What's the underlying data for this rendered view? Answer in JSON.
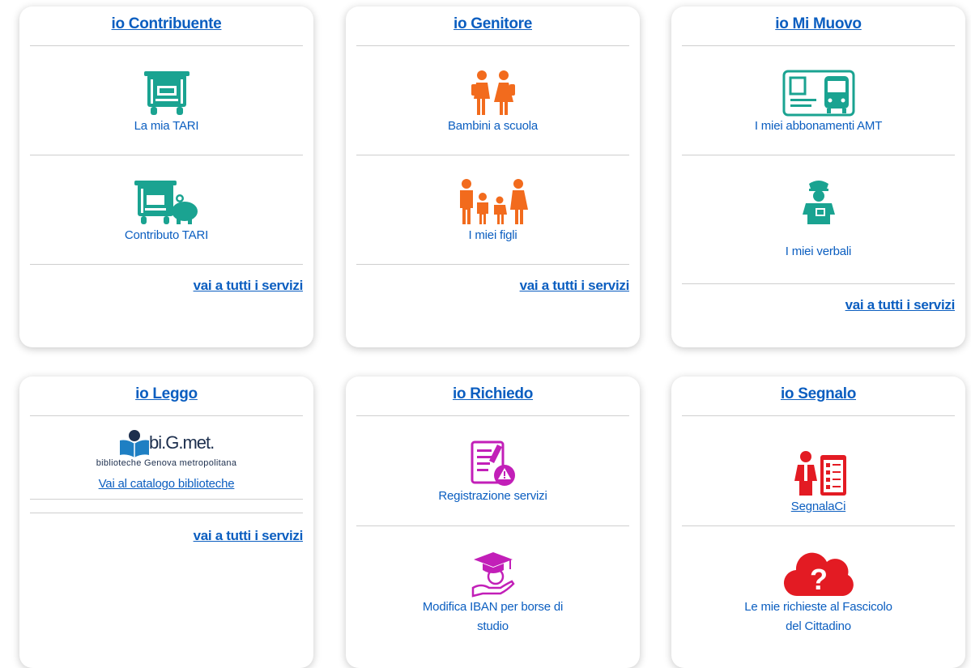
{
  "cards": {
    "contribuente": {
      "title": "io Contribuente",
      "items": [
        {
          "label": "La mia TARI",
          "icon": "garbage-bin-icon"
        },
        {
          "label": "Contributo TARI",
          "icon": "bin-piggy-bank-icon"
        }
      ],
      "all_services": "vai a tutti i servizi"
    },
    "genitore": {
      "title": "io Genitore",
      "items": [
        {
          "label": "Bambini a scuola",
          "icon": "schoolchildren-icon"
        },
        {
          "label": "I miei figli",
          "icon": "family-icon"
        }
      ],
      "all_services": "vai a tutti i servizi"
    },
    "mimuovo": {
      "title": "io Mi Muovo",
      "items": [
        {
          "label": "I miei abbonamenti AMT",
          "icon": "bus-pass-icon"
        },
        {
          "label": "I miei verbali",
          "icon": "traffic-officer-icon"
        }
      ],
      "all_services": "vai a tutti i servizi"
    },
    "leggo": {
      "title": "io Leggo",
      "logo": {
        "name": "bi.G.met.",
        "tagline": "biblioteche Genova metropolitana"
      },
      "items": [
        {
          "label": "Vai al catalogo biblioteche",
          "icon": "bigmet-logo"
        }
      ],
      "all_services": "vai a tutti i servizi"
    },
    "richiedo": {
      "title": "io Richiedo",
      "items": [
        {
          "label": "Registrazione servizi",
          "icon": "form-warning-icon"
        },
        {
          "label": "Modifica IBAN per borse di studio",
          "icon": "scholarship-hand-icon"
        }
      ]
    },
    "segnalo": {
      "title": "io Segnalo",
      "items": [
        {
          "label": "SegnalaCi",
          "icon": "reporter-clipboard-icon"
        },
        {
          "label": "Le mie richieste al Fascicolo del Cittadino",
          "icon": "cloud-question-icon"
        }
      ]
    }
  },
  "colors": {
    "link": "#0b5ec0",
    "teal": "#1aa391",
    "orange": "#f26b1d",
    "magenta": "#c21fb8",
    "red": "#e31b23"
  }
}
